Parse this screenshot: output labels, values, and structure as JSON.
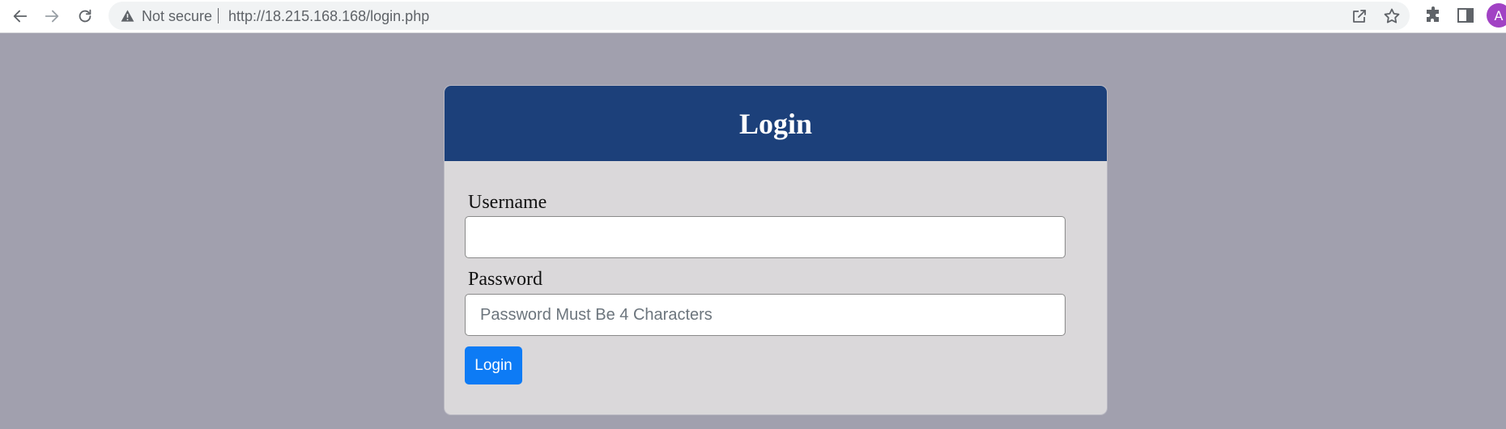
{
  "browser": {
    "security_label": "Not secure",
    "url": "http://18.215.168.168/login.php",
    "profile_initial": "A",
    "icons": {
      "back": "arrow-left-icon",
      "forward": "arrow-right-icon",
      "reload": "reload-icon",
      "warning": "warning-triangle-icon",
      "share": "share-icon",
      "bookmark": "star-icon",
      "extensions": "puzzle-icon",
      "side_panel": "side-panel-icon"
    }
  },
  "login_form": {
    "title": "Login",
    "username_label": "Username",
    "username_value": "",
    "password_label": "Password",
    "password_placeholder": "Password Must Be 4 Characters",
    "password_value": "",
    "submit_label": "Login"
  },
  "colors": {
    "page_background": "#a1a0ae",
    "card_header": "#1c407a",
    "card_body": "#dad8da",
    "button": "#0d7bf5",
    "avatar": "#a142c4"
  }
}
